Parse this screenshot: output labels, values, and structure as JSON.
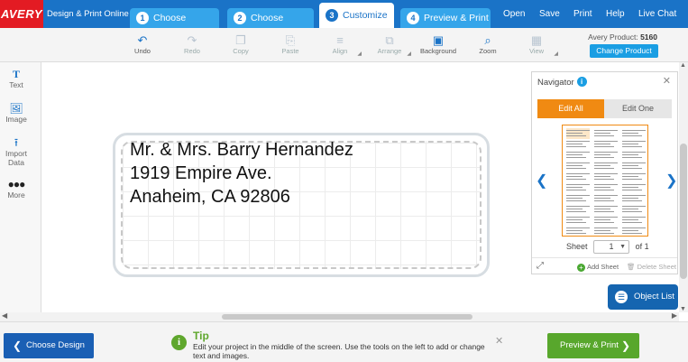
{
  "brand": {
    "logo": "AVERY",
    "subtitle": "Design & Print Online"
  },
  "steps": [
    {
      "num": "1",
      "label": "Choose Product"
    },
    {
      "num": "2",
      "label": "Choose Design"
    },
    {
      "num": "3",
      "label": "Customize"
    },
    {
      "num": "4",
      "label": "Preview & Print"
    }
  ],
  "top_links": [
    "Open",
    "Save",
    "Print",
    "Help",
    "Live Chat"
  ],
  "toolbar": {
    "tools": [
      "Undo",
      "Redo",
      "Copy",
      "Paste",
      "Align",
      "Arrange",
      "Background",
      "Zoom",
      "View"
    ],
    "product_label": "Avery Product:",
    "product_number": "5160",
    "change_product": "Change Product"
  },
  "sidebar": [
    "Text",
    "Image",
    "Import Data",
    "More"
  ],
  "label": {
    "lines": [
      "Mr. & Mrs. Barry Hernandez",
      "1919 Empire Ave.",
      "Anaheim, CA 92806"
    ]
  },
  "navigator": {
    "title": "Navigator",
    "edit_all": "Edit All",
    "edit_one": "Edit One",
    "sheet_label": "Sheet",
    "sheet_value": "1",
    "sheet_of": "of 1",
    "add_sheet": "Add Sheet",
    "delete_sheet": "Delete Sheet"
  },
  "object_list": "Object List",
  "bottom": {
    "choose_design": "Choose Design",
    "tip_title": "Tip",
    "tip_text": "Edit your project in the middle of the screen. Use the tools on the left to add or change text and images.",
    "preview_print": "Preview & Print"
  },
  "colors": {
    "nav_blue": "#1a73c7",
    "step_blue": "#35a5ea",
    "avery_red": "#e31b23",
    "orange": "#f08a12",
    "green": "#58a72c"
  },
  "icons": [
    "undo-icon",
    "redo-icon",
    "copy-icon",
    "paste-icon",
    "align-icon",
    "arrange-icon",
    "background-icon",
    "zoom-icon",
    "view-icon",
    "text-icon",
    "image-icon",
    "import-data-icon",
    "more-icon",
    "info-icon",
    "close-icon",
    "expand-icon",
    "plus-icon",
    "delete-icon",
    "layers-icon",
    "chevron-left-icon",
    "chevron-right-icon",
    "tip-info-icon"
  ]
}
